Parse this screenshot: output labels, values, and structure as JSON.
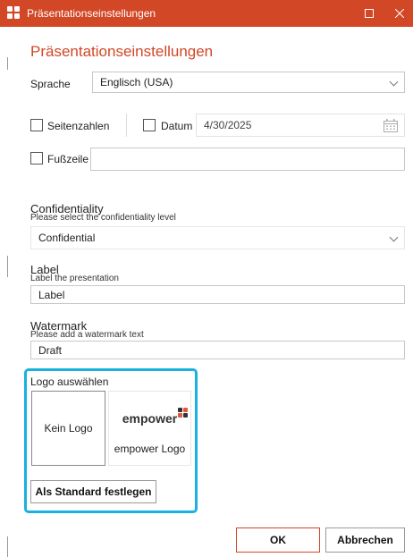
{
  "window": {
    "title": "Präsentationseinstellungen"
  },
  "heading": "Präsentationseinstellungen",
  "language": {
    "label": "Sprache",
    "value": "Englisch (USA)"
  },
  "page_numbers": {
    "label": "Seitenzahlen",
    "checked": false
  },
  "date": {
    "label": "Datum",
    "value": "4/30/2025",
    "checked": false
  },
  "footer": {
    "label": "Fußzeile",
    "checked": false,
    "value": ""
  },
  "confidentiality": {
    "title": "Confidentiality",
    "subtitle": "Please select the confidentiality level",
    "value": "Confidential"
  },
  "label_section": {
    "title": "Label",
    "subtitle": "Label the presentation",
    "value": "Label"
  },
  "watermark": {
    "title": "Watermark",
    "subtitle": "Please add a watermark text",
    "value": "Draft"
  },
  "logo": {
    "title": "Logo auswählen",
    "options": [
      {
        "label": "Kein Logo",
        "selected": true
      },
      {
        "label": "empower Logo",
        "brand": "empower",
        "selected": false
      }
    ],
    "set_default_label": "Als Standard festlegen"
  },
  "buttons": {
    "ok": "OK",
    "cancel": "Abbrechen"
  },
  "colors": {
    "accent": "#d24726",
    "highlight": "#1ab0e0"
  }
}
